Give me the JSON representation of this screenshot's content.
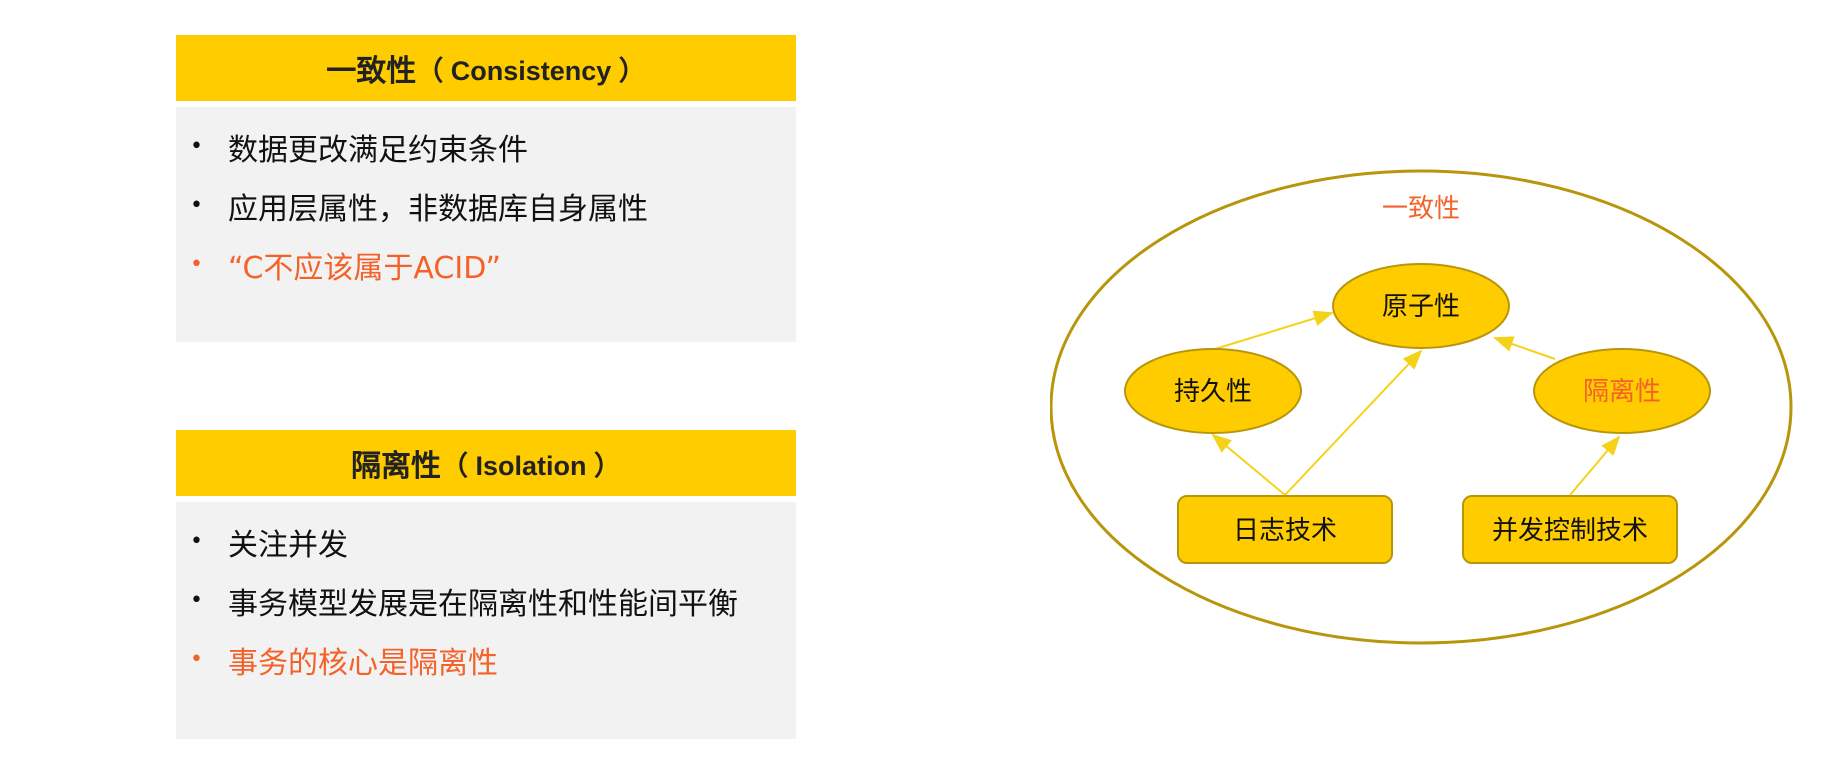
{
  "consistency": {
    "title": "一致性",
    "title_en": "（ Consistency ）",
    "bullets": [
      {
        "text": "数据更改满足约束条件",
        "accent": false
      },
      {
        "text": "应用层属性，非数据库自身属性",
        "accent": false
      },
      {
        "text": "“C不应该属于ACID”",
        "accent": true
      }
    ]
  },
  "isolation": {
    "title": "隔离性",
    "title_en": "（ Isolation ）",
    "bullets": [
      {
        "text": "关注并发",
        "accent": false
      },
      {
        "text": "事务模型发展是在隔离性和性能间平衡",
        "accent": false
      },
      {
        "text": "事务的核心是隔离性",
        "accent": true
      }
    ]
  },
  "diagram": {
    "outer_label": "一致性",
    "nodes": {
      "atomicity": "原子性",
      "durability": "持久性",
      "isolation": "隔离性",
      "logging": "日志技术",
      "concurrency": "并发控制技术"
    }
  },
  "colors": {
    "yellow": "#ffcc00",
    "panel_gray": "#f2f2f2",
    "accent_orange": "#f4622a",
    "outline_gold": "#b8960c",
    "arrow_yellow": "#f5d21a"
  }
}
